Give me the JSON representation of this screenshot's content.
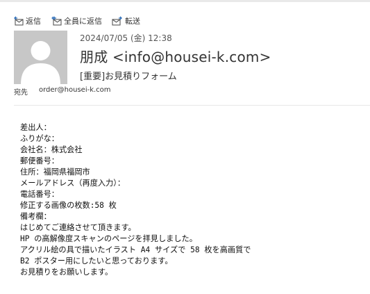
{
  "toolbar": {
    "reply_label": "返信",
    "reply_all_label": "全員に返信",
    "forward_label": "転送"
  },
  "message": {
    "datetime": "2024/07/05 (金) 12:38",
    "sender": "朋成 <info@housei-k.com>",
    "subject": "[重要]お見積りフォーム",
    "to_label": "宛先",
    "to_address": "order@housei-k.com"
  },
  "body_lines": [
    "差出人：",
    "ふりがな：",
    "会社名：株式会社",
    "郵便番号：",
    "住所：福岡県福岡市",
    "メールアドレス（再度入力）：",
    "電話番号：",
    "修正する画像の枚数:58 枚",
    "備考欄：",
    "はじめてご連絡させて頂きます。",
    "HP の高解像度スキャンのページを拝見しました。",
    "アクリル絵の具で描いたイラスト A4 サイズで 58 枚を高画質で",
    "B2 ポスター用にしたいと思っております。",
    "お見積りをお願いします。"
  ]
}
